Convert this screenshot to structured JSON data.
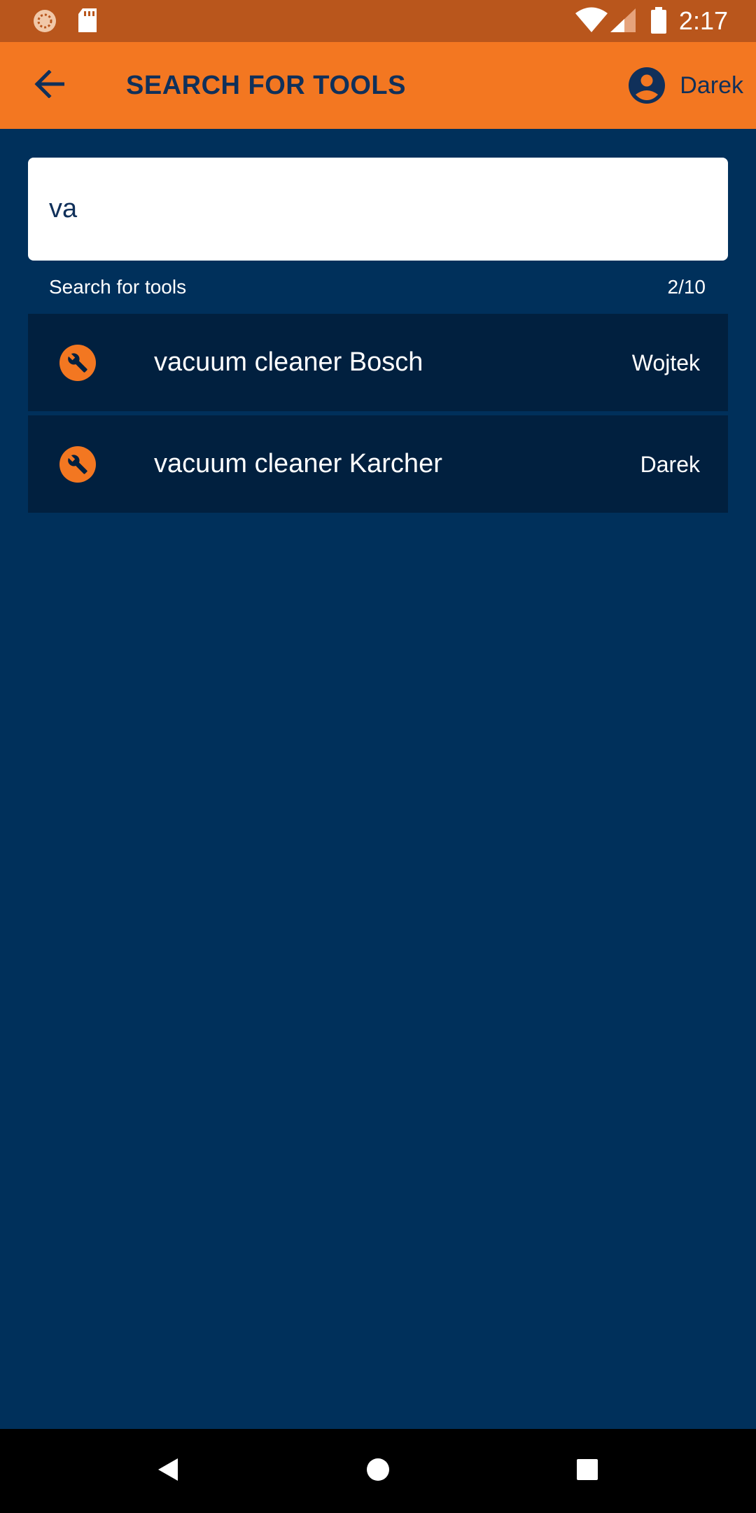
{
  "status_bar": {
    "time": "2:17",
    "icons": [
      "sync-icon",
      "sd-card-icon",
      "wifi-icon",
      "cell-signal-icon",
      "battery-icon"
    ]
  },
  "app_bar": {
    "title": "SEARCH FOR TOOLS",
    "back_icon": "arrow-back-icon",
    "user_icon": "account-circle-icon",
    "user_name": "Darek"
  },
  "search": {
    "value": "va",
    "helper_text": "Search for tools",
    "counter": "2/10"
  },
  "results": [
    {
      "icon": "wrench-icon",
      "name": "vacuum cleaner Bosch",
      "owner": "Wojtek"
    },
    {
      "icon": "wrench-icon",
      "name": "vacuum cleaner Karcher",
      "owner": "Darek"
    }
  ],
  "nav_bar": {
    "icons": [
      "back-triangle-icon",
      "home-circle-icon",
      "recents-square-icon"
    ]
  },
  "colors": {
    "status_bar": "#b9561c",
    "app_bar": "#f37721",
    "background": "#00305b",
    "row_background": "#01203f",
    "title_text": "#10305a"
  }
}
